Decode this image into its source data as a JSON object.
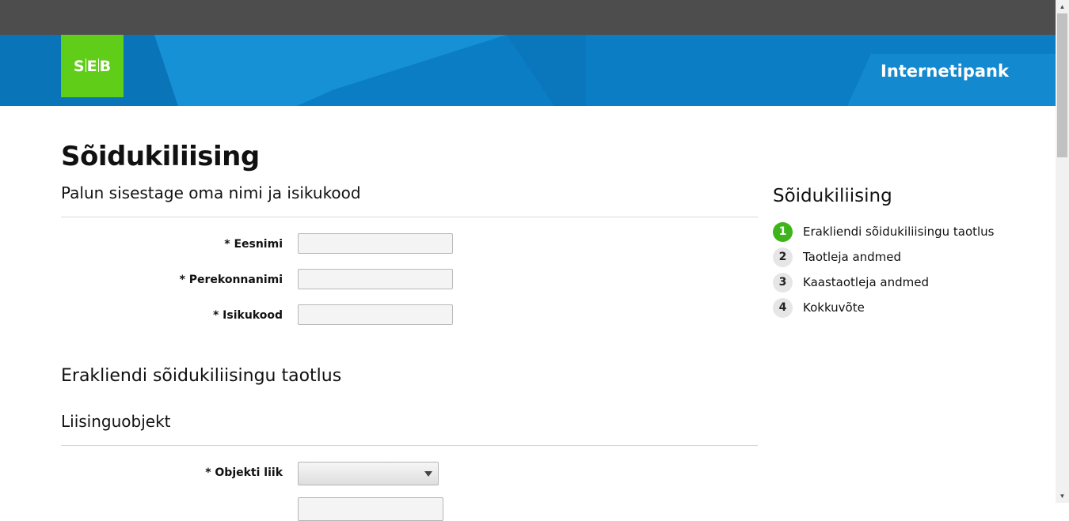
{
  "header": {
    "logo_text_left": "S",
    "logo_text_mid": "E",
    "logo_text_right": "B",
    "banner_title": "Internetipank",
    "colors": {
      "topbar": "#4d4d4d",
      "banner": "#0d84c9",
      "logo": "#60cd18",
      "step_active": "#3fb41a"
    }
  },
  "page": {
    "title": "Sõidukiliising",
    "subtitle": "Palun sisestage oma nimi ja isikukood"
  },
  "personal_form": {
    "first_name": {
      "label": "* Eesnimi",
      "value": ""
    },
    "last_name": {
      "label": "* Perekonnanimi",
      "value": ""
    },
    "id_code": {
      "label": "* Isikukood",
      "value": ""
    }
  },
  "application": {
    "title": "Erakliendi sõidukiliisingu taotlus",
    "object_section": "Liisinguobjekt",
    "object_type": {
      "label": "* Objekti liik",
      "value": ""
    }
  },
  "sidebar": {
    "title": "Sõidukiliising",
    "steps": [
      {
        "num": "1",
        "label": "Erakliendi sõidukiliisingu taotlus",
        "active": true
      },
      {
        "num": "2",
        "label": "Taotleja andmed",
        "active": false
      },
      {
        "num": "3",
        "label": "Kaastaotleja andmed",
        "active": false
      },
      {
        "num": "4",
        "label": "Kokkuvõte",
        "active": false
      }
    ]
  }
}
